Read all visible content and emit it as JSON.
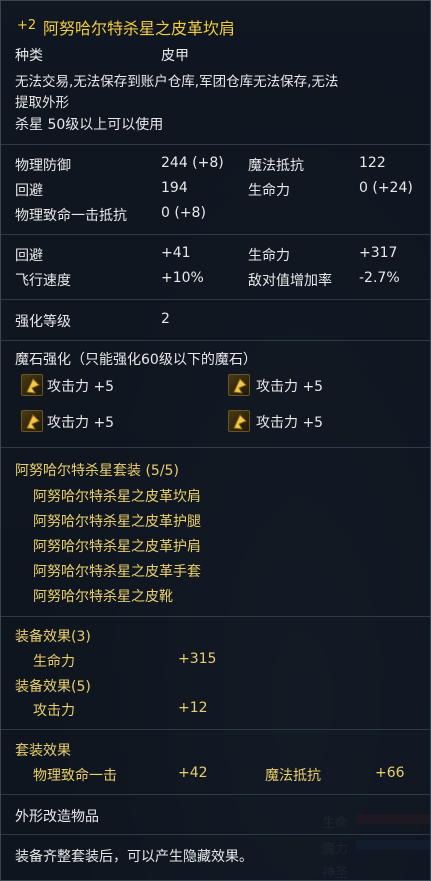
{
  "item": {
    "enhance": "+2",
    "name": "阿努哈尔特杀星之皮革坎肩",
    "type_label": "种类",
    "type_value": "皮甲",
    "restrictions": "无法交易,无法保存到账户仓库,军团仓库无法保存,无法",
    "restrictions_line2": "提取外形",
    "level_req": "杀星 50级以上可以使用"
  },
  "base_stats": {
    "phys_def_label": "物理防御",
    "phys_def_value": "244 (+8)",
    "mag_res_label": "魔法抵抗",
    "mag_res_value": "122",
    "evade_label": "回避",
    "evade_value": "194",
    "hp_label": "生命力",
    "hp_value": "0 (+24)",
    "crit_res_label": "物理致命一击抵抗",
    "crit_res_value": "0 (+8)"
  },
  "bonus_stats": {
    "evade_label": "回避",
    "evade_value": "+41",
    "hp_label": "生命力",
    "hp_value": "+317",
    "flight_label": "飞行速度",
    "flight_value": "+10%",
    "aggro_label": "敌对值增加率",
    "aggro_value": "-2.7%"
  },
  "enchant": {
    "label": "强化等级",
    "value": "2"
  },
  "manastones": {
    "title": "魔石强化（只能强化60级以下的魔石）",
    "slots": [
      {
        "label": "攻击力 +5",
        "icon": "manastone-icon"
      },
      {
        "label": "攻击力 +5",
        "icon": "manastone-icon"
      },
      {
        "label": "攻击力 +5",
        "icon": "manastone-icon"
      },
      {
        "label": "攻击力 +5",
        "icon": "manastone-icon"
      }
    ]
  },
  "set": {
    "title": "阿努哈尔特杀星套装 (5/5)",
    "pieces": [
      "阿努哈尔特杀星之皮革坎肩",
      "阿努哈尔特杀星之皮革护腿",
      "阿努哈尔特杀星之皮革护肩",
      "阿努哈尔特杀星之皮革手套",
      "阿努哈尔特杀星之皮靴"
    ],
    "effect3_title": "装备效果(3)",
    "effect3_stat": "生命力",
    "effect3_value": "+315",
    "effect5_title": "装备效果(5)",
    "effect5_stat": "攻击力",
    "effect5_value": "+12"
  },
  "set_effect": {
    "title": "套装效果",
    "stat1": "物理致命一击",
    "value1": "+42",
    "stat2": "魔法抵抗",
    "value2": "+66"
  },
  "appearance": "外形改造物品",
  "hidden_effect": "装备齐整套装后，可以产生隐藏效果。",
  "hud": {
    "hp_label": "生命",
    "mp_label": "魔力",
    "dp_label": "神圣"
  },
  "colors": {
    "title": "#f2cc3f",
    "set_piece": "#e9cf6b",
    "hp_bar": "#b83232",
    "mp_bar": "#2f5fa8"
  }
}
